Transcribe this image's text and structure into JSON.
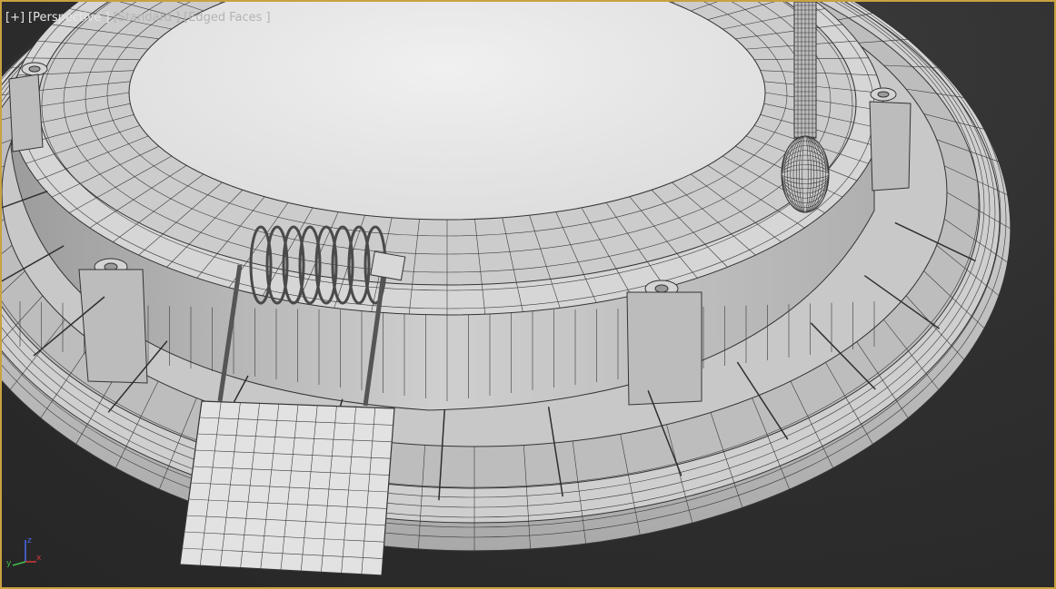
{
  "viewport": {
    "label_plus": "[+]",
    "label_view": "[Perspective ]",
    "label_shading": "[Standard ]",
    "label_mode": "[Edged Faces ]"
  },
  "gizmo": {
    "x_label": "x",
    "y_label": "y",
    "z_label": "z",
    "x_color": "#d23a3a",
    "y_color": "#3fbf4a",
    "z_color": "#4a6cf0"
  },
  "colors": {
    "border_accent": "#c9a23f",
    "mesh_fill": "#d9d9d9",
    "wire": "#2e2e2e",
    "background": "#2b2b2b"
  }
}
